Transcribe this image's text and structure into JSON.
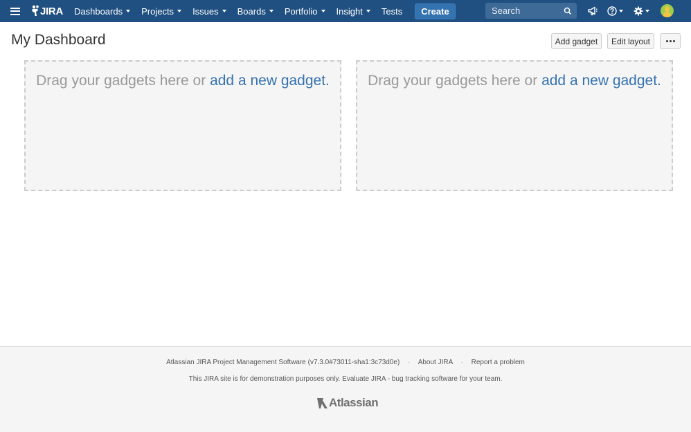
{
  "header": {
    "logo_text": "JIRA",
    "nav": [
      {
        "label": "Dashboards"
      },
      {
        "label": "Projects"
      },
      {
        "label": "Issues"
      },
      {
        "label": "Boards"
      },
      {
        "label": "Portfolio"
      },
      {
        "label": "Insight"
      },
      {
        "label": "Tests"
      }
    ],
    "create_label": "Create",
    "search_placeholder": "Search",
    "icons": [
      "menu-icon",
      "jira-logo-icon",
      "search-icon",
      "announcement-icon",
      "help-icon",
      "settings-icon",
      "avatar-icon"
    ],
    "colors": {
      "bar": "#205081",
      "create": "#3572b0"
    }
  },
  "dashboard": {
    "title": "My Dashboard",
    "add_gadget_label": "Add gadget",
    "edit_layout_label": "Edit layout",
    "more_icon": "ellipsis-icon",
    "columns": [
      {
        "hint_prefix": "Drag your gadgets here or",
        "hint_link": "add a new gadget."
      },
      {
        "hint_prefix": "Drag your gadgets here or",
        "hint_link": "add a new gadget."
      }
    ]
  },
  "footer": {
    "software": "Atlassian JIRA Project Management Software (v7.3.0#73011-sha1:3c73d0e)",
    "about": "About JIRA",
    "report": "Report a problem",
    "separator": "·",
    "notice": "This JIRA site is for demonstration purposes only. Evaluate JIRA - bug tracking software for your team.",
    "logo_text": "Atlassian"
  }
}
